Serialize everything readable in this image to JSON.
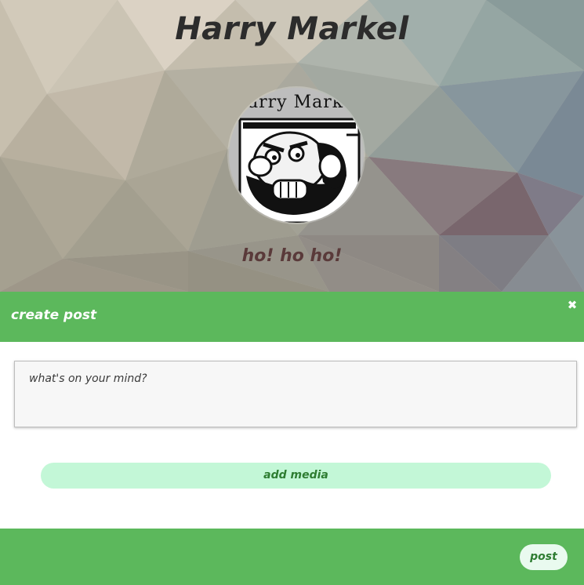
{
  "profile": {
    "name": "Harry Markel",
    "avatar_caption": "Harry Markel",
    "status": "ho! ho ho!"
  },
  "modal": {
    "title": "create post",
    "close_icon": "close-icon",
    "textarea_placeholder": "what's on your mind?",
    "add_media_label": "add media",
    "post_label": "post"
  },
  "colors": {
    "header_green": "#5cb85c",
    "add_media_bg": "#c3f7d7",
    "button_text": "#2e7d32"
  }
}
